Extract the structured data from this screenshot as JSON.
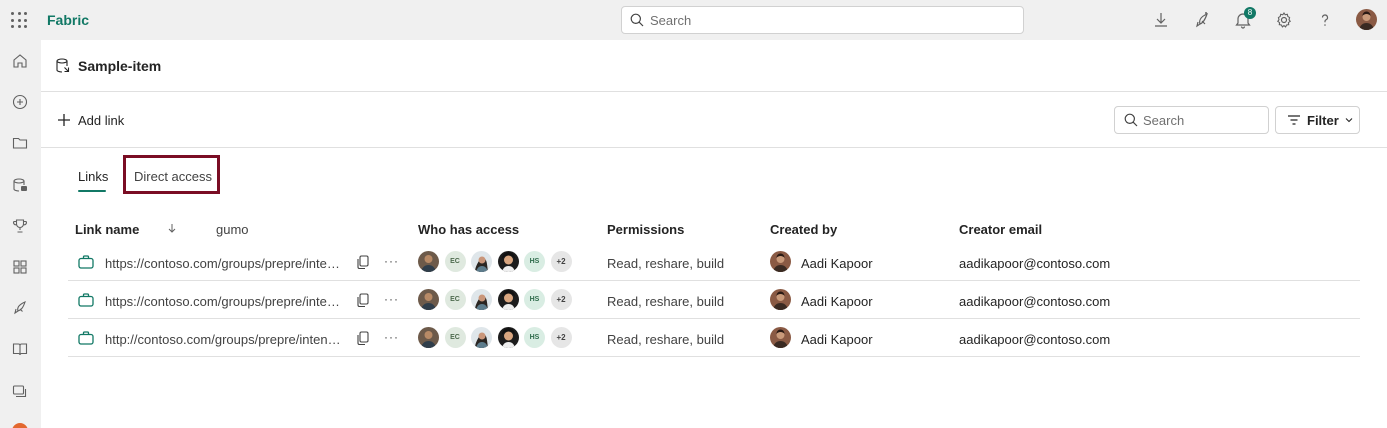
{
  "app": {
    "brand": "Fabric",
    "search_placeholder": "Search",
    "notification_count": "8",
    "icons": [
      "waffle-icon",
      "download-icon",
      "rocket-icon",
      "bell-icon",
      "gear-icon",
      "help-icon"
    ]
  },
  "rail": {
    "icons": [
      "home-icon",
      "create-icon",
      "browse-icon",
      "data-hub-icon",
      "trophy-icon",
      "apps-icon",
      "deployment-icon",
      "learn-icon",
      "workspaces-icon"
    ]
  },
  "item": {
    "title": "Sample-item"
  },
  "toolbar": {
    "add_link_label": "Add link",
    "search_placeholder": "Search",
    "filter_label": "Filter"
  },
  "tabs": {
    "links": "Links",
    "direct_access": "Direct access"
  },
  "table": {
    "columns": {
      "link_name": "Link name",
      "extra": "gumo",
      "who_has_access": "Who has access",
      "permissions": "Permissions",
      "created_by": "Created by",
      "creator_email": "Creator email"
    },
    "rows": [
      {
        "link": "https://contoso.com/groups/prepre/intent/sample-item",
        "avatars": [
          "EC",
          "HS"
        ],
        "more": "+2",
        "permissions": "Read, reshare, build",
        "creator": "Aadi Kapoor",
        "email": "aadikapoor@contoso.com"
      },
      {
        "link": "https://contoso.com/groups/prepre/intent/sample-item",
        "avatars": [
          "EC",
          "HS"
        ],
        "more": "+2",
        "permissions": "Read, reshare, build",
        "creator": "Aadi Kapoor",
        "email": "aadikapoor@contoso.com"
      },
      {
        "link": "http://contoso.com/groups/prepre/intent/sample-item",
        "avatars": [
          "EC",
          "HS"
        ],
        "more": "+2",
        "permissions": "Read, reshare, build",
        "creator": "Aadi Kapoor",
        "email": "aadikapoor@contoso.com"
      }
    ]
  },
  "colors": {
    "brand": "#117865",
    "highlight": "#7a0d24"
  }
}
